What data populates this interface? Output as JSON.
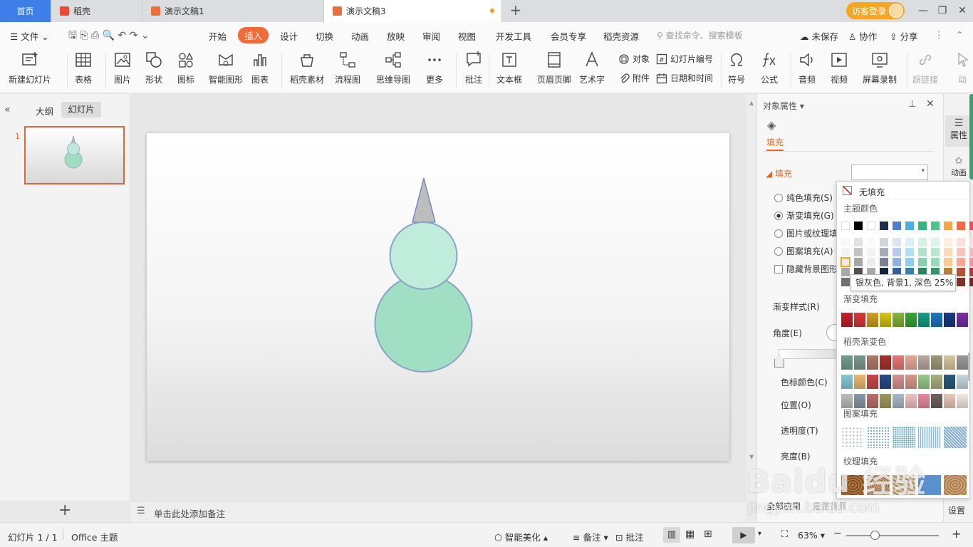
{
  "tabs": {
    "home": "首页",
    "docer": "稻壳",
    "doc1": "演示文稿1",
    "doc3": "演示文稿3",
    "add": "+"
  },
  "account": {
    "login": "访客登录"
  },
  "menu": {
    "file": "文件",
    "items": [
      "开始",
      "插入",
      "设计",
      "切换",
      "动画",
      "放映",
      "审阅",
      "视图",
      "开发工具",
      "会员专享",
      "稻壳资源"
    ],
    "search_placeholder": "查找命令、搜索模板",
    "unsaved": "未保存",
    "collab": "协作",
    "share": "分享"
  },
  "ribbon": {
    "new_slide": "新建幻灯片",
    "table": "表格",
    "picture": "图片",
    "shape": "形状",
    "icon": "图标",
    "smart_shape": "智能图形",
    "chart": "图表",
    "docer_material": "稻壳素材",
    "flowchart": "流程图",
    "mindmap": "思维导图",
    "more": "更多",
    "comment": "批注",
    "textbox": "文本框",
    "header_footer": "页眉页脚",
    "wordart": "艺术字",
    "object": "对象",
    "attachment": "附件",
    "slide_number": "幻灯片编号",
    "datetime": "日期和时间",
    "symbol": "符号",
    "formula": "公式",
    "audio": "音频",
    "video": "视频",
    "screen_record": "屏幕录制",
    "hyperlink": "超链接",
    "action": "动"
  },
  "left_panel": {
    "outline": "大纲",
    "slides": "幻灯片",
    "slide_index": "1"
  },
  "notes": {
    "placeholder": "单击此处添加备注"
  },
  "properties": {
    "title": "对象属性",
    "fill_tab": "填充",
    "fill_section": "填充",
    "solid": "纯色填充(S)",
    "gradient": "渐变填充(G)",
    "picture_texture": "图片或纹理填",
    "pattern": "图案填充(A)",
    "hide_bg": "隐藏背景图形",
    "gradient_style": "渐变样式(R)",
    "angle": "角度(E)",
    "stop_color": "色标颜色(C)",
    "position": "位置(O)",
    "transparency": "透明度(T)",
    "brightness": "亮度(B)",
    "apply_all": "全部应用",
    "reset_bg": "重置背景"
  },
  "side_rail": {
    "attributes": "属性",
    "animation": "动画",
    "settings": "设置"
  },
  "color_popup": {
    "no_fill": "无填充",
    "theme_colors": "主题颜色",
    "gradient_fill": "渐变填充",
    "docer_gradient": "稻壳渐变色",
    "pattern_fill": "图案填充",
    "texture_fill": "纹理填充",
    "tooltip": "银灰色, 背景1, 深色 25%",
    "theme_row": [
      "#ffffff",
      "#000000",
      "#ffffff",
      "#1f2d4a",
      "#4a7fd1",
      "#4aaee0",
      "#36b37e",
      "#4cc48a",
      "#f5a64a",
      "#f06a4a",
      "#e84f5a"
    ],
    "gradient_row": [
      "#c8202a",
      "#e0383a",
      "#d4a020",
      "#d8c810",
      "#86b83a",
      "#36a83a",
      "#17a085",
      "#1e78c8",
      "#1a3a8a",
      "#7a2ea8"
    ]
  },
  "status": {
    "slide_count": "幻灯片 1 / 1",
    "theme": "Office 主题",
    "beautify": "智能美化",
    "notes": "备注",
    "comments": "批注",
    "zoom": "63%"
  },
  "watermark": {
    "brand": "Baidu 经验",
    "url": "jingyan.baidu.com"
  }
}
